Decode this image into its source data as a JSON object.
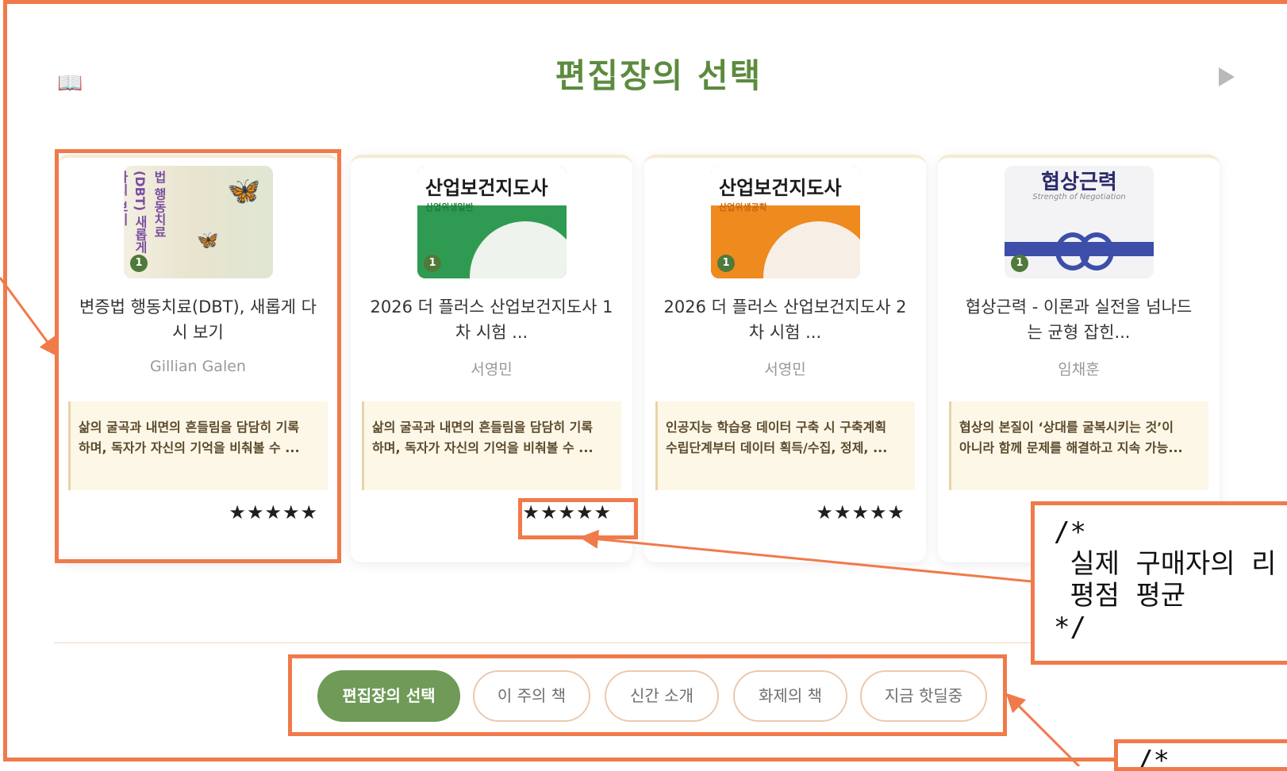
{
  "section": {
    "title": "편집장의 선택",
    "book_icon": "📖",
    "next_icon": "play-arrow-icon"
  },
  "books": [
    {
      "badge": "1",
      "cover_title": "법 행동치료(DBT) 새롭게 다시 보기",
      "cover_sub": "",
      "title_line1": "변증법 행동치료(DBT), 새롭게 다",
      "title_line2": "시 보기",
      "author": "Gillian Galen",
      "desc_line1": "삶의 굴곡과 내면의 흔들림을 담담히 기록",
      "desc_line2": "하며, 독자가 자신의 기억을 비춰볼 수 ...",
      "stars": "★★★★★"
    },
    {
      "badge": "1",
      "cover_title": "산업보건지도사",
      "cover_sub": "산업위생일반",
      "title_line1": "2026 더 플러스 산업보건지도사 1",
      "title_line2": "차 시험 ...",
      "author": "서영민",
      "desc_line1": "삶의 굴곡과 내면의 흔들림을 담담히 기록",
      "desc_line2": "하며, 독자가 자신의 기억을 비춰볼 수 ...",
      "stars": "★★★★★"
    },
    {
      "badge": "1",
      "cover_title": "산업보건지도사",
      "cover_sub": "산업위생공학",
      "title_line1": "2026 더 플러스 산업보건지도사 2",
      "title_line2": "차 시험 ...",
      "author": "서영민",
      "desc_line1": "인공지능 학습용 데이터 구축 시 구축계획",
      "desc_line2": "수립단계부터 데이터 획득/수집, 정제, ...",
      "stars": "★★★★★"
    },
    {
      "badge": "1",
      "cover_title": "협상근력",
      "cover_sub": "Strength of Negotiation",
      "title_line1": "협상근력 - 이론과 실전을 넘나드",
      "title_line2": "는 균형 잡힌...",
      "author": "임채훈",
      "desc_line1": "협상의 본질이 ‘상대를 굴복시키는 것’이",
      "desc_line2": "아니라 함께 문제를 해결하고 지속 가능...",
      "stars": "★★★★★"
    }
  ],
  "tabs": [
    {
      "label": "편집장의 선택",
      "active": true
    },
    {
      "label": "이 주의 책",
      "active": false
    },
    {
      "label": "신간 소개",
      "active": false
    },
    {
      "label": "화제의 책",
      "active": false
    },
    {
      "label": "지금 핫딜중",
      "active": false
    }
  ],
  "annotations": {
    "rating_comment": "/*\n 실제 구매자의 리\n 평점 평균\n*/",
    "tabs_comment": "/*"
  },
  "colors": {
    "accent_green": "#5c8b3e",
    "annotation_orange": "#f07a4a",
    "desc_bg": "#fdf7e8"
  }
}
